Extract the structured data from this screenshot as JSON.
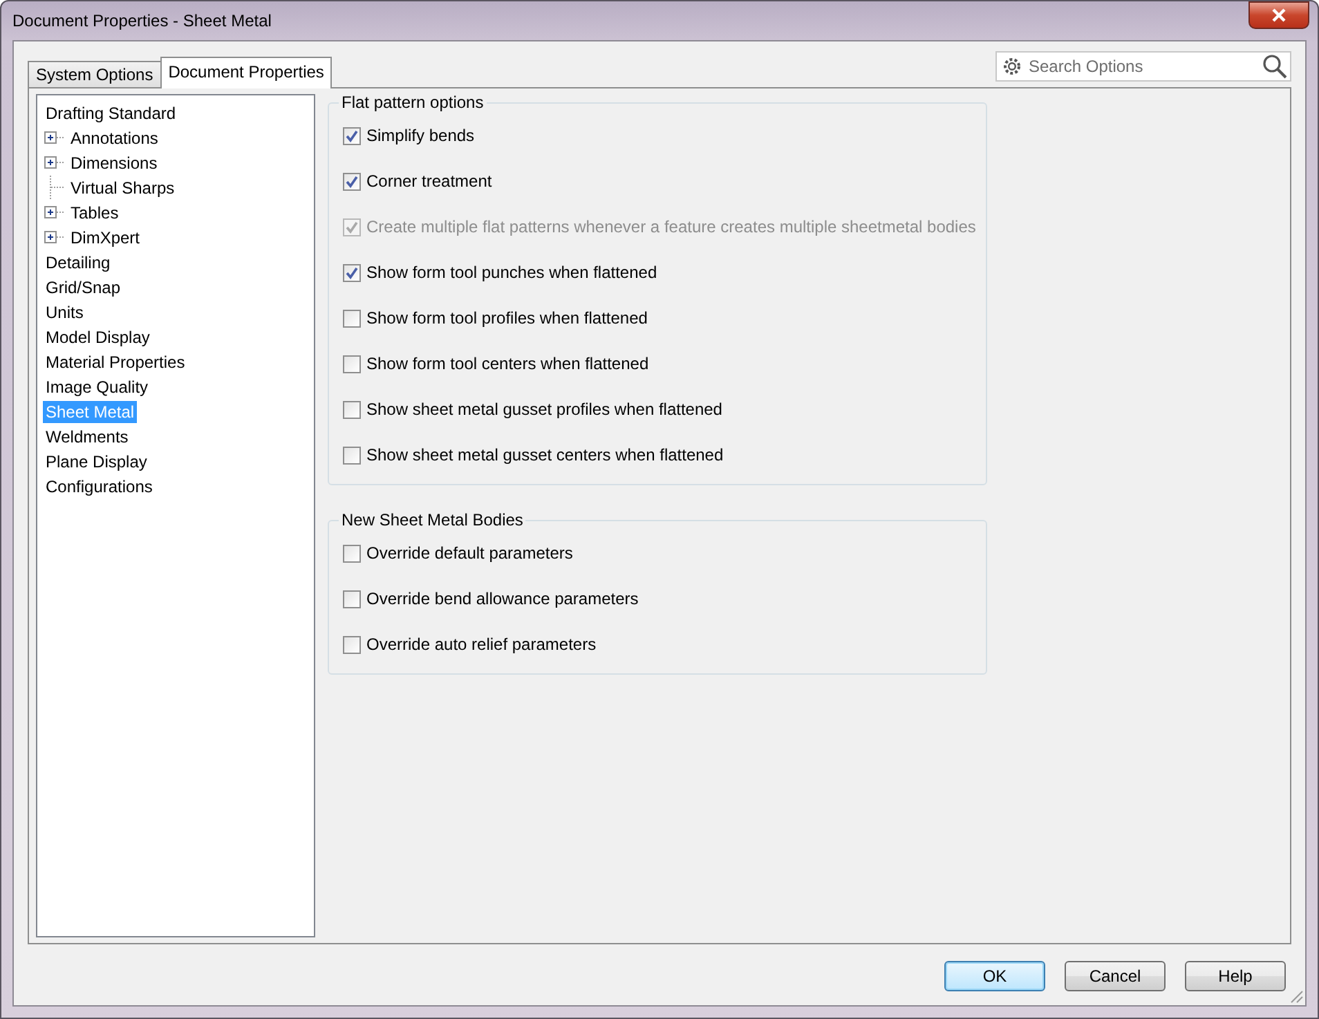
{
  "window": {
    "title": "Document Properties - Sheet Metal"
  },
  "tabs": [
    {
      "label": "System Options",
      "selected": false
    },
    {
      "label": "Document Properties",
      "selected": true
    }
  ],
  "search": {
    "placeholder": "Search Options"
  },
  "sidebar": {
    "items": [
      {
        "label": "Drafting Standard",
        "selected": false,
        "children": [
          {
            "label": "Annotations",
            "selected": false,
            "expanded": false
          },
          {
            "label": "Dimensions",
            "selected": false,
            "expanded": false
          },
          {
            "label": "Virtual Sharps",
            "selected": false
          },
          {
            "label": "Tables",
            "selected": false,
            "expanded": false
          },
          {
            "label": "DimXpert",
            "selected": false,
            "expanded": false
          }
        ]
      },
      {
        "label": "Detailing",
        "selected": false
      },
      {
        "label": "Grid/Snap",
        "selected": false
      },
      {
        "label": "Units",
        "selected": false
      },
      {
        "label": "Model Display",
        "selected": false
      },
      {
        "label": "Material Properties",
        "selected": false
      },
      {
        "label": "Image Quality",
        "selected": false
      },
      {
        "label": "Sheet Metal",
        "selected": true
      },
      {
        "label": "Weldments",
        "selected": false
      },
      {
        "label": "Plane Display",
        "selected": false
      },
      {
        "label": "Configurations",
        "selected": false
      }
    ]
  },
  "groups": [
    {
      "title": "Flat pattern options",
      "options": [
        {
          "label": "Simplify bends",
          "checked": true,
          "disabled": false
        },
        {
          "label": "Corner treatment",
          "checked": true,
          "disabled": false
        },
        {
          "label": "Create multiple flat patterns whenever a feature creates multiple sheetmetal bodies",
          "checked": true,
          "disabled": true
        },
        {
          "label": "Show form tool punches when flattened",
          "checked": true,
          "disabled": false
        },
        {
          "label": "Show form tool profiles when flattened",
          "checked": false,
          "disabled": false
        },
        {
          "label": "Show form tool centers when flattened",
          "checked": false,
          "disabled": false
        },
        {
          "label": "Show sheet metal gusset profiles when flattened",
          "checked": false,
          "disabled": false
        },
        {
          "label": "Show sheet metal gusset centers when flattened",
          "checked": false,
          "disabled": false
        }
      ]
    },
    {
      "title": "New Sheet Metal Bodies",
      "options": [
        {
          "label": "Override default parameters",
          "checked": false,
          "disabled": false
        },
        {
          "label": "Override bend allowance parameters",
          "checked": false,
          "disabled": false
        },
        {
          "label": "Override auto relief parameters",
          "checked": false,
          "disabled": false
        }
      ]
    }
  ],
  "buttons": [
    {
      "label": "OK",
      "default": true
    },
    {
      "label": "Cancel",
      "default": false
    },
    {
      "label": "Help",
      "default": false
    }
  ]
}
